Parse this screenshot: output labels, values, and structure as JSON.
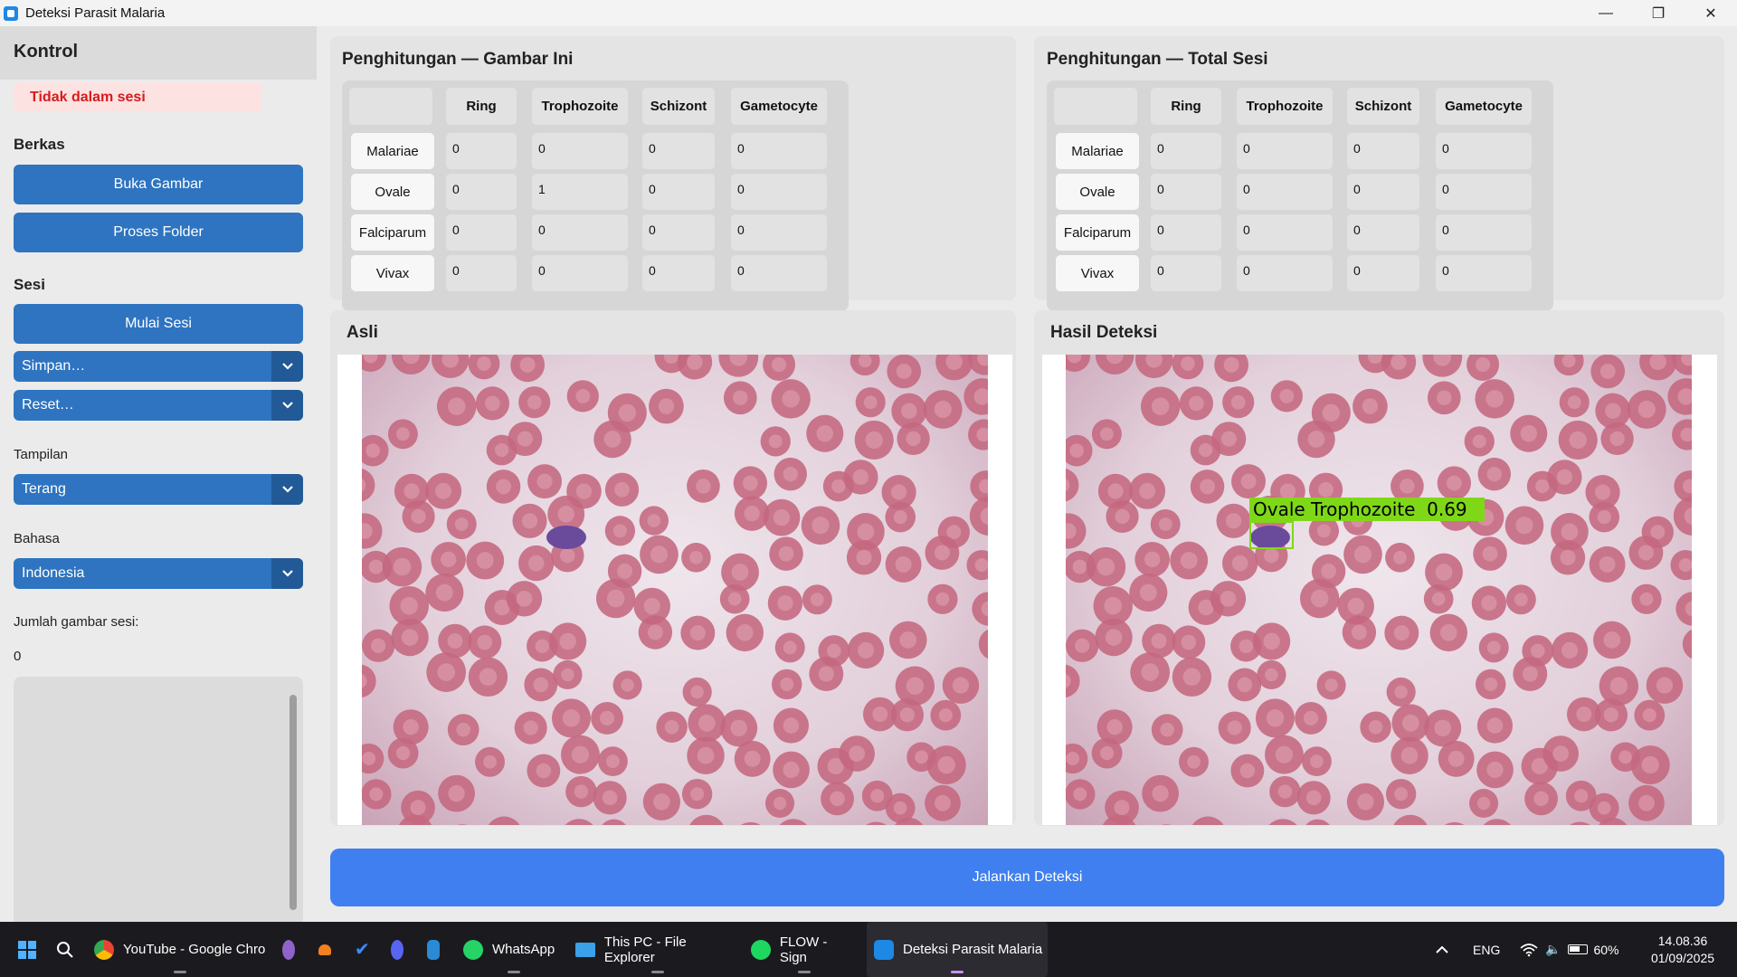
{
  "window": {
    "title": "Deteksi Parasit Malaria",
    "controls": [
      "—",
      "❐",
      "✕"
    ]
  },
  "sidebar": {
    "header": "Kontrol",
    "session_status": "Tidak dalam sesi",
    "files_label": "Berkas",
    "open_image": "Buka Gambar",
    "process_folder": "Proses Folder",
    "session_label": "Sesi",
    "start_session": "Mulai Sesi",
    "save_menu": "Simpan…",
    "reset_menu": "Reset…",
    "theme_label": "Tampilan",
    "theme_value": "Terang",
    "language_label": "Bahasa",
    "language_value": "Indonesia",
    "session_count_label": "Jumlah gambar sesi:",
    "session_count_value": "0"
  },
  "count_image": {
    "title": "Penghitungan — Gambar Ini",
    "columns": [
      "Ring",
      "Trophozoite",
      "Schizont",
      "Gametocyte"
    ],
    "rows": [
      {
        "label": "Malariae",
        "values": [
          "0",
          "0",
          "0",
          "0"
        ]
      },
      {
        "label": "Ovale",
        "values": [
          "0",
          "1",
          "0",
          "0"
        ]
      },
      {
        "label": "Falciparum",
        "values": [
          "0",
          "0",
          "0",
          "0"
        ]
      },
      {
        "label": "Vivax",
        "values": [
          "0",
          "0",
          "0",
          "0"
        ]
      }
    ]
  },
  "count_session": {
    "title": "Penghitungan — Total Sesi",
    "columns": [
      "Ring",
      "Trophozoite",
      "Schizont",
      "Gametocyte"
    ],
    "rows": [
      {
        "label": "Malariae",
        "values": [
          "0",
          "0",
          "0",
          "0"
        ]
      },
      {
        "label": "Ovale",
        "values": [
          "0",
          "0",
          "0",
          "0"
        ]
      },
      {
        "label": "Falciparum",
        "values": [
          "0",
          "0",
          "0",
          "0"
        ]
      },
      {
        "label": "Vivax",
        "values": [
          "0",
          "0",
          "0",
          "0"
        ]
      }
    ]
  },
  "original_panel": {
    "title": "Asli"
  },
  "detection_panel": {
    "title": "Hasil Deteksi",
    "detection_label": "Ovale Trophozoite  0.69"
  },
  "run_button": "Jalankan Deteksi",
  "taskbar": {
    "apps": [
      {
        "label": "YouTube - Google Chro"
      },
      {
        "label": "WhatsApp"
      },
      {
        "label": "This PC - File Explorer"
      },
      {
        "label": "FLOW - Sign"
      },
      {
        "label": "Deteksi Parasit Malaria"
      }
    ],
    "language": "ENG",
    "battery": "60%",
    "time": "14.08.36",
    "date": "01/09/2025"
  }
}
